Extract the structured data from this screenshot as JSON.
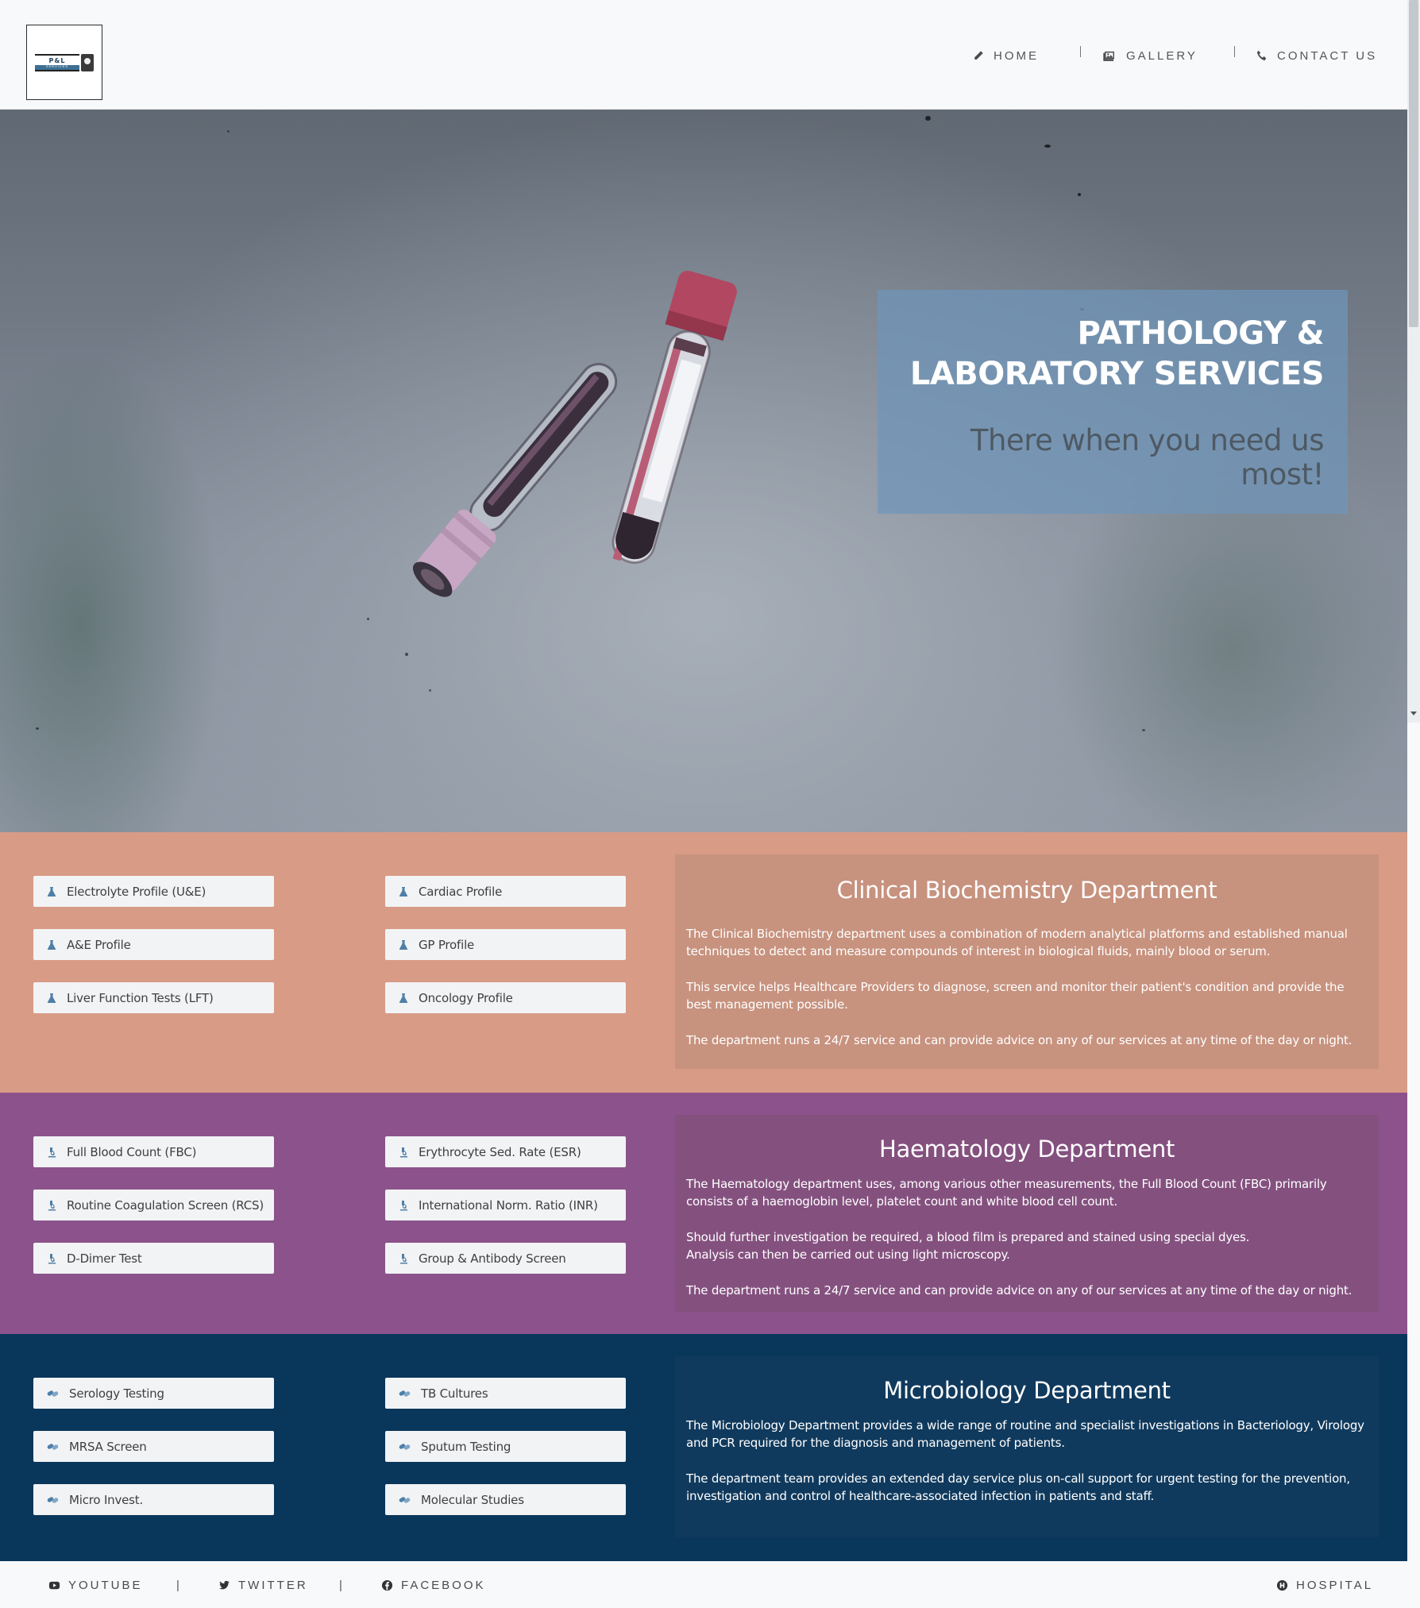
{
  "logo": {
    "line1": "P&L",
    "line2": "SERVICES"
  },
  "nav": {
    "home": "Home",
    "gallery": "Gallery",
    "contact": "Contact Us"
  },
  "hero": {
    "title_line1": "PATHOLOGY &",
    "title_line2": "LABORATORY SERVICES",
    "subtitle": "There when you need us most!"
  },
  "biochemistry": {
    "title": "Clinical Biochemistry Department",
    "tests": [
      "Electrolyte Profile (U&E)",
      "Cardiac Profile",
      "A&E Profile",
      "GP Profile",
      "Liver Function Tests (LFT)",
      "Oncology Profile"
    ],
    "paragraphs": [
      "The Clinical Biochemistry department uses a combination of modern analytical platforms and established manual techniques to detect and measure compounds of interest in biological fluids, mainly blood or serum.",
      "This service helps Healthcare Providers to diagnose, screen and monitor their patient's condition and provide the best management possible.",
      "The department runs a 24/7 service and can provide advice on any of our services at any time of the day or night."
    ]
  },
  "haematology": {
    "title": "Haematology Department",
    "tests": [
      "Full Blood Count (FBC)",
      "Erythrocyte Sed. Rate (ESR)",
      "Routine Coagulation Screen (RCS)",
      "International Norm. Ratio (INR)",
      "D-Dimer Test",
      "Group & Antibody Screen"
    ],
    "paragraphs": [
      "The Haematology department uses, among various other measurements, the Full Blood Count (FBC) primarily consists of a haemoglobin level, platelet count and white blood cell count.",
      "Should further investigation be required, a blood film is prepared and stained using special dyes.",
      "Analysis can then be carried out using light microscopy.",
      "The department runs a 24/7 service and can provide advice on any of our services at any time of the day or night."
    ]
  },
  "microbiology": {
    "title": "Microbiology Department",
    "tests": [
      "Serology Testing",
      "TB Cultures",
      "MRSA Screen",
      "Sputum Testing",
      "Micro Invest.",
      "Molecular Studies"
    ],
    "paragraphs": [
      "The Microbiology Department provides a wide range of routine and specialist investigations in Bacteriology, Virology and PCR required for the diagnosis and management of patients.",
      "The department team provides an extended day service plus on-call support for urgent testing for the prevention, investigation and control of healthcare-associated infection in patients and staff."
    ]
  },
  "footer": {
    "youtube": "YouTube",
    "twitter": "Twitter",
    "facebook": "Facebook",
    "hospital": "Hospital",
    "separator": "|"
  },
  "colors": {
    "biochemistry_bg": "#d89b86",
    "haematology_bg": "#8b528b",
    "microbiology_bg": "#09365b",
    "hero_box": "#6f95ba",
    "icon_blue": "#4f7fa6"
  }
}
